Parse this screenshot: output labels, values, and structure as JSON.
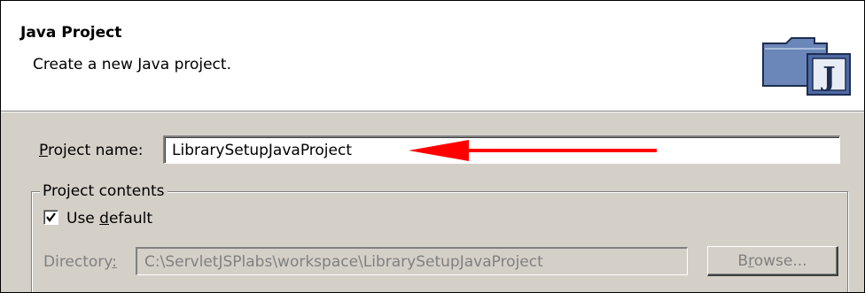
{
  "wizard": {
    "title": "Java Project",
    "description": "Create a new Java project.",
    "icon": "java-project-folder-icon"
  },
  "project_name": {
    "label_prefix": "",
    "label_mnemonic": "P",
    "label_rest": "roject name:",
    "value": "LibrarySetupJavaProject"
  },
  "annotation": {
    "icon": "red-arrow-icon",
    "color": "#ff0000"
  },
  "project_contents": {
    "legend": "Project contents",
    "use_default": {
      "checked": true,
      "label_prefix": "Use ",
      "label_mnemonic": "d",
      "label_rest": "efault"
    },
    "directory": {
      "label_prefix": "Directory",
      "label_mnemonic": ":",
      "value": "C:\\ServletJSPlabs\\workspace\\LibrarySetupJavaProject"
    },
    "browse": {
      "label_prefix": "B",
      "label_mnemonic": "r",
      "label_rest": "owse..."
    }
  }
}
